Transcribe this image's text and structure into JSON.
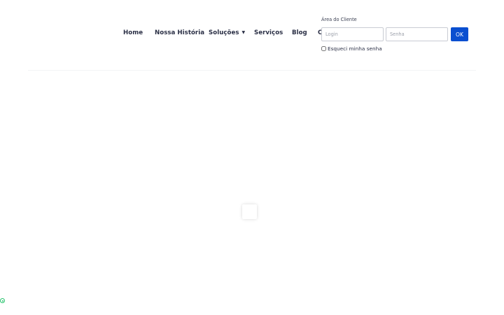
{
  "nav": {
    "items": [
      {
        "label": "Home"
      },
      {
        "label": "Nossa História"
      },
      {
        "label": "Soluções",
        "caret": "▼"
      },
      {
        "label": "Serviços"
      },
      {
        "label": "Blog"
      },
      {
        "label": "C"
      }
    ]
  },
  "client_area": {
    "title": "Área do Cliente",
    "login_placeholder": "Login",
    "password_placeholder": "Senha",
    "ok_label": "OK",
    "forgot_label": "Esqueci minha senha"
  },
  "colors": {
    "accent": "#0a4fd0",
    "status_green": "#25c26b",
    "nav_text": "#2a2f45"
  },
  "icons": {
    "status": "whatsapp-icon",
    "loader": "loading-spinner"
  }
}
